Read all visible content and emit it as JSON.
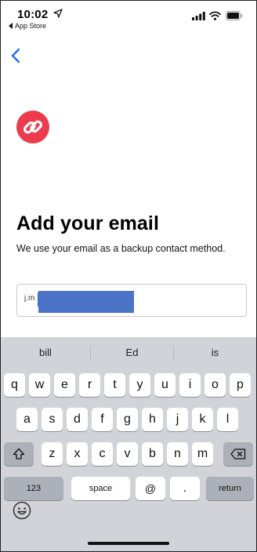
{
  "status_bar": {
    "time": "10:02",
    "back_app_label": "App Store",
    "icons": [
      "location-arrow-icon",
      "signal-bars-icon",
      "wifi-icon",
      "battery-icon"
    ]
  },
  "nav": {
    "back_icon": "chevron-left-icon"
  },
  "brand": {
    "logo_icon": "link-logo-icon",
    "logo_color": "#ec3b4c"
  },
  "content": {
    "title": "Add your email",
    "subtitle": "We use your email as a backup contact method."
  },
  "email_input": {
    "value": "j.m",
    "redaction_color": "#4b74c9"
  },
  "keyboard": {
    "suggestions": [
      "bill",
      "Ed",
      "is"
    ],
    "row1": [
      "q",
      "w",
      "e",
      "r",
      "t",
      "y",
      "u",
      "i",
      "o",
      "p"
    ],
    "row2": [
      "a",
      "s",
      "d",
      "f",
      "g",
      "h",
      "j",
      "k",
      "l"
    ],
    "row3": [
      "z",
      "x",
      "c",
      "v",
      "b",
      "n",
      "m"
    ],
    "shift_icon": "shift-arrow-icon",
    "delete_icon": "backspace-icon",
    "bottom": {
      "numbers_label": "123",
      "space_label": "space",
      "at_label": "@",
      "period_label": ".",
      "return_label": "return"
    },
    "emoji_icon": "emoji-smiley-icon"
  }
}
